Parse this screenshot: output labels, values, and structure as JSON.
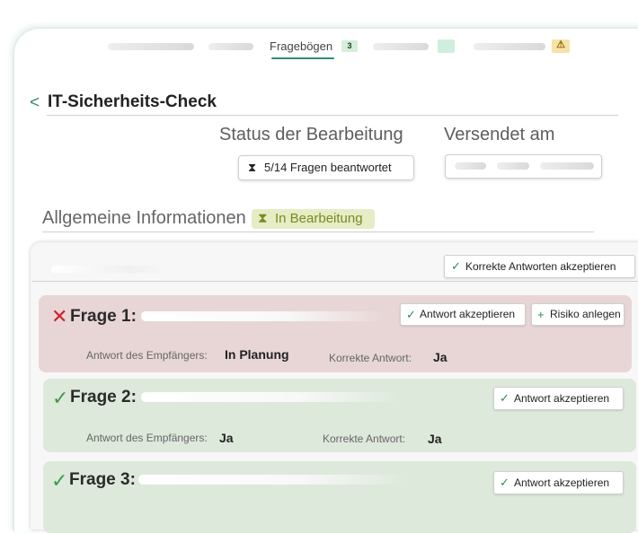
{
  "nav": {
    "active_tab": "Fragebögen",
    "active_tab_count": "3",
    "warning_icon": "⚠"
  },
  "header": {
    "back_icon": "<",
    "title": "IT-Sicherheits-Check"
  },
  "overview": {
    "status_label": "Status der Bearbeitung",
    "status_icon": "hourglass-icon",
    "status_value": "5/14 Fragen beantwortet",
    "sent_label": "Versendet am"
  },
  "section": {
    "title": "Allgemeine Informationen",
    "badge_label": "In Bearbeitung",
    "accept_all_label": "Korrekte Antworten akzeptieren"
  },
  "questions": [
    {
      "title": "Frage 1:",
      "state": "incorrect",
      "recipient_label": "Antwort des Empfängers:",
      "recipient_answer": "In Planung",
      "correct_label": "Korrekte Antwort:",
      "correct_answer": "Ja",
      "accept_label": "Antwort akzeptieren",
      "risk_label": "Risiko anlegen"
    },
    {
      "title": "Frage 2:",
      "state": "correct",
      "recipient_label": "Antwort des Empfängers:",
      "recipient_answer": "Ja",
      "correct_label": "Korrekte Antwort:",
      "correct_answer": "Ja",
      "accept_label": "Antwort akzeptieren"
    },
    {
      "title": "Frage 3:",
      "state": "correct",
      "accept_label": "Antwort akzeptieren"
    }
  ],
  "icons": {
    "check": "✓",
    "cross": "✕",
    "plus": "+",
    "hourglass": "⧗"
  },
  "colors": {
    "accent": "#2f8f6b",
    "incorrect": "#d0202a",
    "correct": "#3f9a4a",
    "card_incorrect_bg": "#e8d6d6",
    "card_correct_bg": "#dde9db",
    "badge_bg": "#e6ecc6",
    "badge_text": "#7d8a20"
  }
}
